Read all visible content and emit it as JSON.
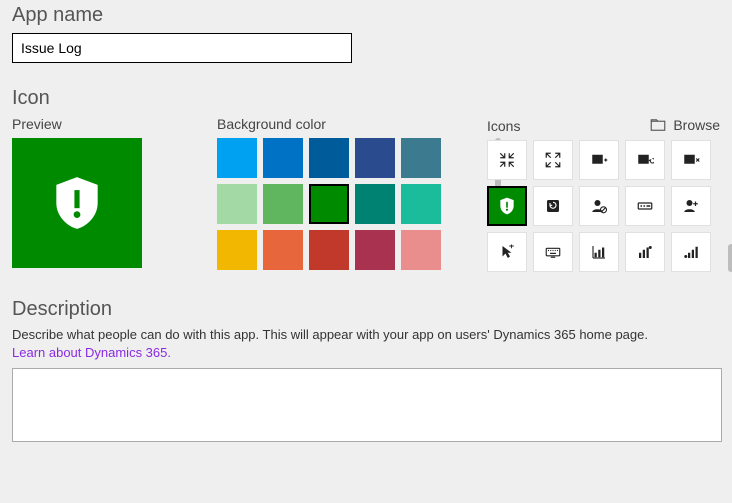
{
  "appName": {
    "label": "App name",
    "value": "Issue Log"
  },
  "icon": {
    "label": "Icon",
    "previewLabel": "Preview",
    "bgLabel": "Background color",
    "iconsLabel": "Icons",
    "browseLabel": "Browse",
    "colors": [
      "#00a1f1",
      "#0072c6",
      "#005b9a",
      "#2a4b8d",
      "#3b7a8f",
      "#a3d9a5",
      "#5fb65f",
      "#008a00",
      "#008272",
      "#1abc9c",
      "#f2b700",
      "#e8663c",
      "#c0392b",
      "#a83250",
      "#e98d8d"
    ],
    "selectedColorIndex": 7,
    "iconNames": [
      "collapse-icon",
      "expand-icon",
      "add-card-icon",
      "undo-card-icon",
      "remove-card-icon",
      "shield-alert-icon",
      "refresh-icon",
      "user-block-icon",
      "credential-icon",
      "user-add-icon",
      "pointer-icon",
      "keyboard-icon",
      "bar-chart-icon",
      "bar-chart-alt-icon",
      "signal-icon"
    ],
    "selectedIconIndex": 5
  },
  "description": {
    "label": "Description",
    "help": "Describe what people can do with this app. This will appear with your app on users' Dynamics 365 home page.",
    "linkText": "Learn about Dynamics 365",
    "value": ""
  }
}
